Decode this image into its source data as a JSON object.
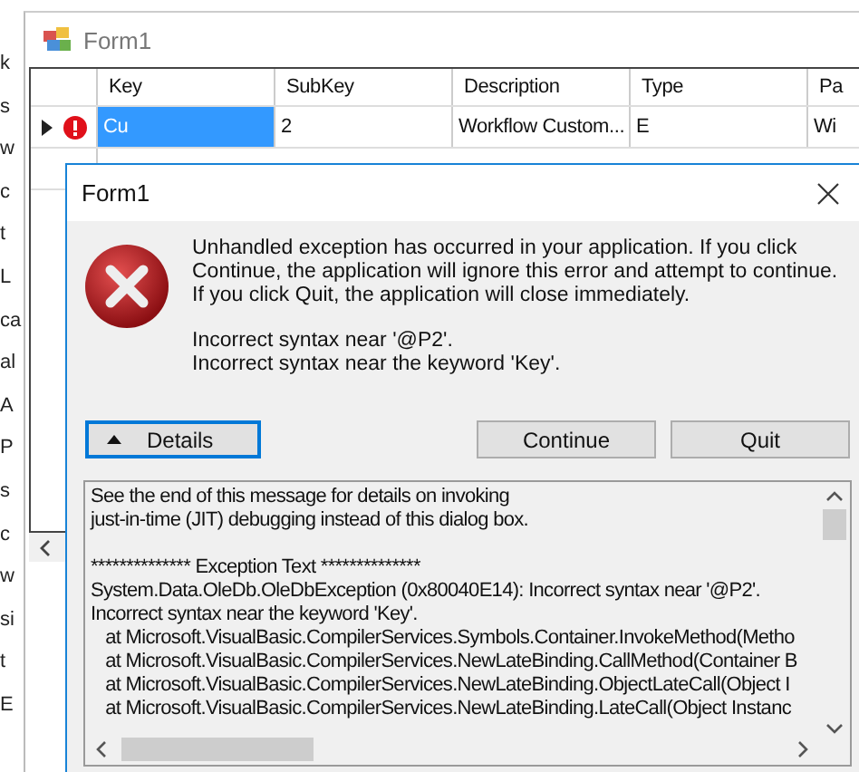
{
  "background_fragments": [
    "k",
    "s",
    "w",
    "c",
    "t",
    "L",
    "ca",
    "al",
    "A",
    "P",
    "s",
    "c",
    "w",
    "si",
    "t",
    "E"
  ],
  "window": {
    "title": "Form1"
  },
  "grid": {
    "columns": [
      "Key",
      "SubKey",
      "Description",
      "Type",
      "Pa"
    ],
    "rows": [
      {
        "current": true,
        "error": true,
        "cells": [
          {
            "text": "Cu",
            "selected": true
          },
          {
            "text": "2",
            "selected": false
          },
          {
            "text": "Workflow Custom...",
            "selected": false
          },
          {
            "text": "E",
            "selected": false
          },
          {
            "text": "Wi",
            "selected": false
          }
        ]
      }
    ]
  },
  "dialog": {
    "title": "Form1",
    "message": "Unhandled exception has occurred in your application. If you click Continue, the application will ignore this error and attempt to continue. If you click Quit, the application will close immediately.",
    "errors": [
      "Incorrect syntax near '@P2'.",
      "Incorrect syntax near the keyword 'Key'."
    ],
    "buttons": [
      {
        "label": "Details",
        "kind": "toggle",
        "expanded": true,
        "focused": true
      },
      {
        "label": "Continue",
        "kind": "plain",
        "focused": false
      },
      {
        "label": "Quit",
        "kind": "plain",
        "focused": false
      }
    ],
    "details_intro": [
      "See the end of this message for details on invoking",
      "just-in-time (JIT) debugging instead of this dialog box."
    ],
    "details": [
      "************** Exception Text **************",
      "System.Data.OleDb.OleDbException (0x80040E14): Incorrect syntax near '@P2'.",
      "Incorrect syntax near the keyword 'Key'.",
      "   at Microsoft.VisualBasic.CompilerServices.Symbols.Container.InvokeMethod(Metho",
      "   at Microsoft.VisualBasic.CompilerServices.NewLateBinding.CallMethod(Container B",
      "   at Microsoft.VisualBasic.CompilerServices.NewLateBinding.ObjectLateCall(Object I",
      "   at Microsoft.VisualBasic.CompilerServices.NewLateBinding.LateCall(Object Instanc"
    ]
  }
}
